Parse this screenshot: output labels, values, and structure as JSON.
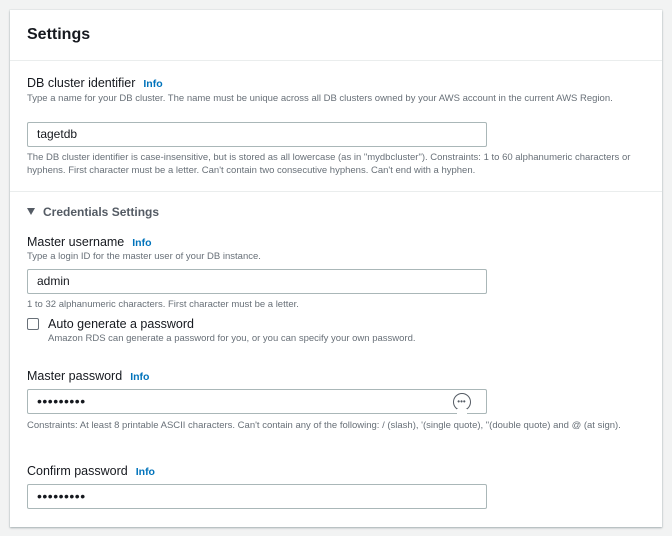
{
  "settings": {
    "title": "Settings",
    "cluster_identifier": {
      "label": "DB cluster identifier",
      "info": "Info",
      "description": "Type a name for your DB cluster. The name must be unique across all DB clusters owned by your AWS account in the current AWS Region.",
      "value": "tagetdb",
      "constraints": "The DB cluster identifier is case-insensitive, but is stored as all lowercase (as in \"mydbcluster\"). Constraints: 1 to 60 alphanumeric characters or hyphens. First character must be a letter. Can't contain two consecutive hyphens. Can't end with a hyphen."
    },
    "credentials": {
      "title": "Credentials Settings",
      "master_username": {
        "label": "Master username",
        "info": "Info",
        "description": "Type a login ID for the master user of your DB instance.",
        "value": "admin",
        "constraints": "1 to 32 alphanumeric characters. First character must be a letter."
      },
      "auto_generate": {
        "label": "Auto generate a password",
        "description": "Amazon RDS can generate a password for you, or you can specify your own password.",
        "checked": false
      },
      "master_password": {
        "label": "Master password",
        "info": "Info",
        "value": "•••••••••",
        "constraints": "Constraints: At least 8 printable ASCII characters. Can't contain any of the following: / (slash), '(single quote), \"(double quote) and @ (at sign)."
      },
      "confirm_password": {
        "label": "Confirm password",
        "info": "Info",
        "value": "•••••••••"
      }
    }
  }
}
